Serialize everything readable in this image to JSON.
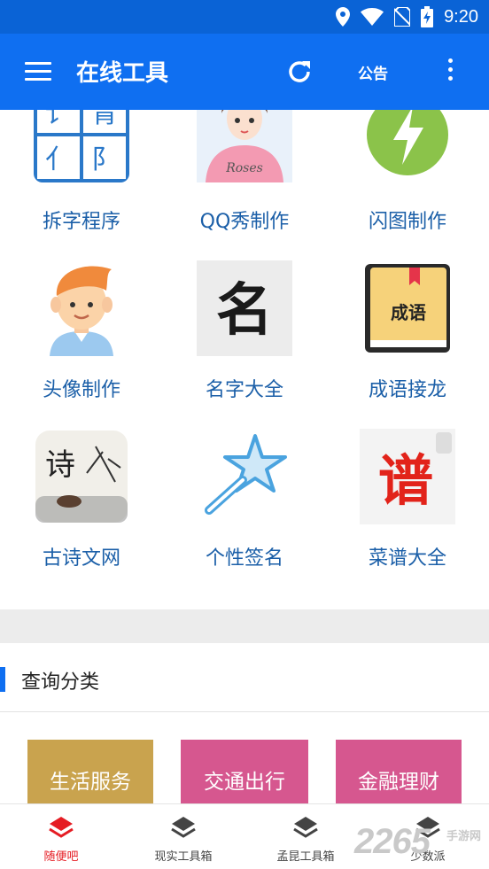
{
  "status_bar": {
    "time": "9:20",
    "icons": [
      "location-icon",
      "wifi-icon",
      "no-sim-icon",
      "battery-charging-icon"
    ]
  },
  "app_bar": {
    "title": "在线工具",
    "notice_label": "公告",
    "icons": [
      "menu-icon",
      "refresh-icon",
      "more-vert-icon"
    ]
  },
  "tools": [
    {
      "label": "拆字程序",
      "icon": "split-char-icon"
    },
    {
      "label": "QQ秀制作",
      "icon": "qq-show-icon"
    },
    {
      "label": "闪图制作",
      "icon": "flash-icon"
    },
    {
      "label": "头像制作",
      "icon": "avatar-icon"
    },
    {
      "label": "名字大全",
      "icon": "name-icon",
      "glyph": "名"
    },
    {
      "label": "成语接龙",
      "icon": "idiom-book-icon",
      "glyph": "成语"
    },
    {
      "label": "古诗文网",
      "icon": "poetry-icon",
      "glyph": "诗"
    },
    {
      "label": "个性签名",
      "icon": "magic-wand-icon"
    },
    {
      "label": "菜谱大全",
      "icon": "recipe-icon",
      "glyph": "谱"
    }
  ],
  "split_icon_glyphs": [
    "讠",
    "青",
    "亻",
    "阝"
  ],
  "section": {
    "title": "查询分类"
  },
  "categories": [
    {
      "label": "生活服务",
      "color": "#c9a34e"
    },
    {
      "label": "交通出行",
      "color": "#d6578f"
    },
    {
      "label": "金融理财",
      "color": "#d6578f"
    }
  ],
  "bottom_nav": [
    {
      "label": "随便吧",
      "active": true
    },
    {
      "label": "现实工具箱",
      "active": false
    },
    {
      "label": "孟昆工具箱",
      "active": false
    },
    {
      "label": "少数派",
      "active": false
    }
  ],
  "watermark": {
    "number": "2265",
    "site": "手游网"
  },
  "colors": {
    "primary": "#0f6ff1",
    "status_bar": "#0a63d6",
    "tool_label": "#1b5fa8",
    "active_nav": "#e51c23"
  }
}
